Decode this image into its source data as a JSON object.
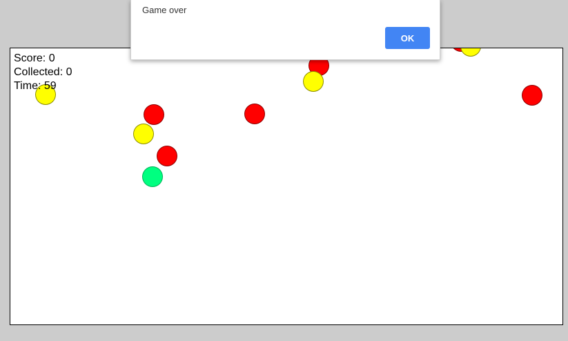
{
  "dialog": {
    "message": "Game over",
    "ok_label": "OK"
  },
  "hud": {
    "score_label": "Score: 0",
    "collected_label": "Collected: 0",
    "time_label": "Time: 59"
  },
  "colors": {
    "hazard": "#ff0000",
    "collectible": "#ffff00",
    "player": "#00ff80",
    "ok_button": "#4285f4"
  }
}
